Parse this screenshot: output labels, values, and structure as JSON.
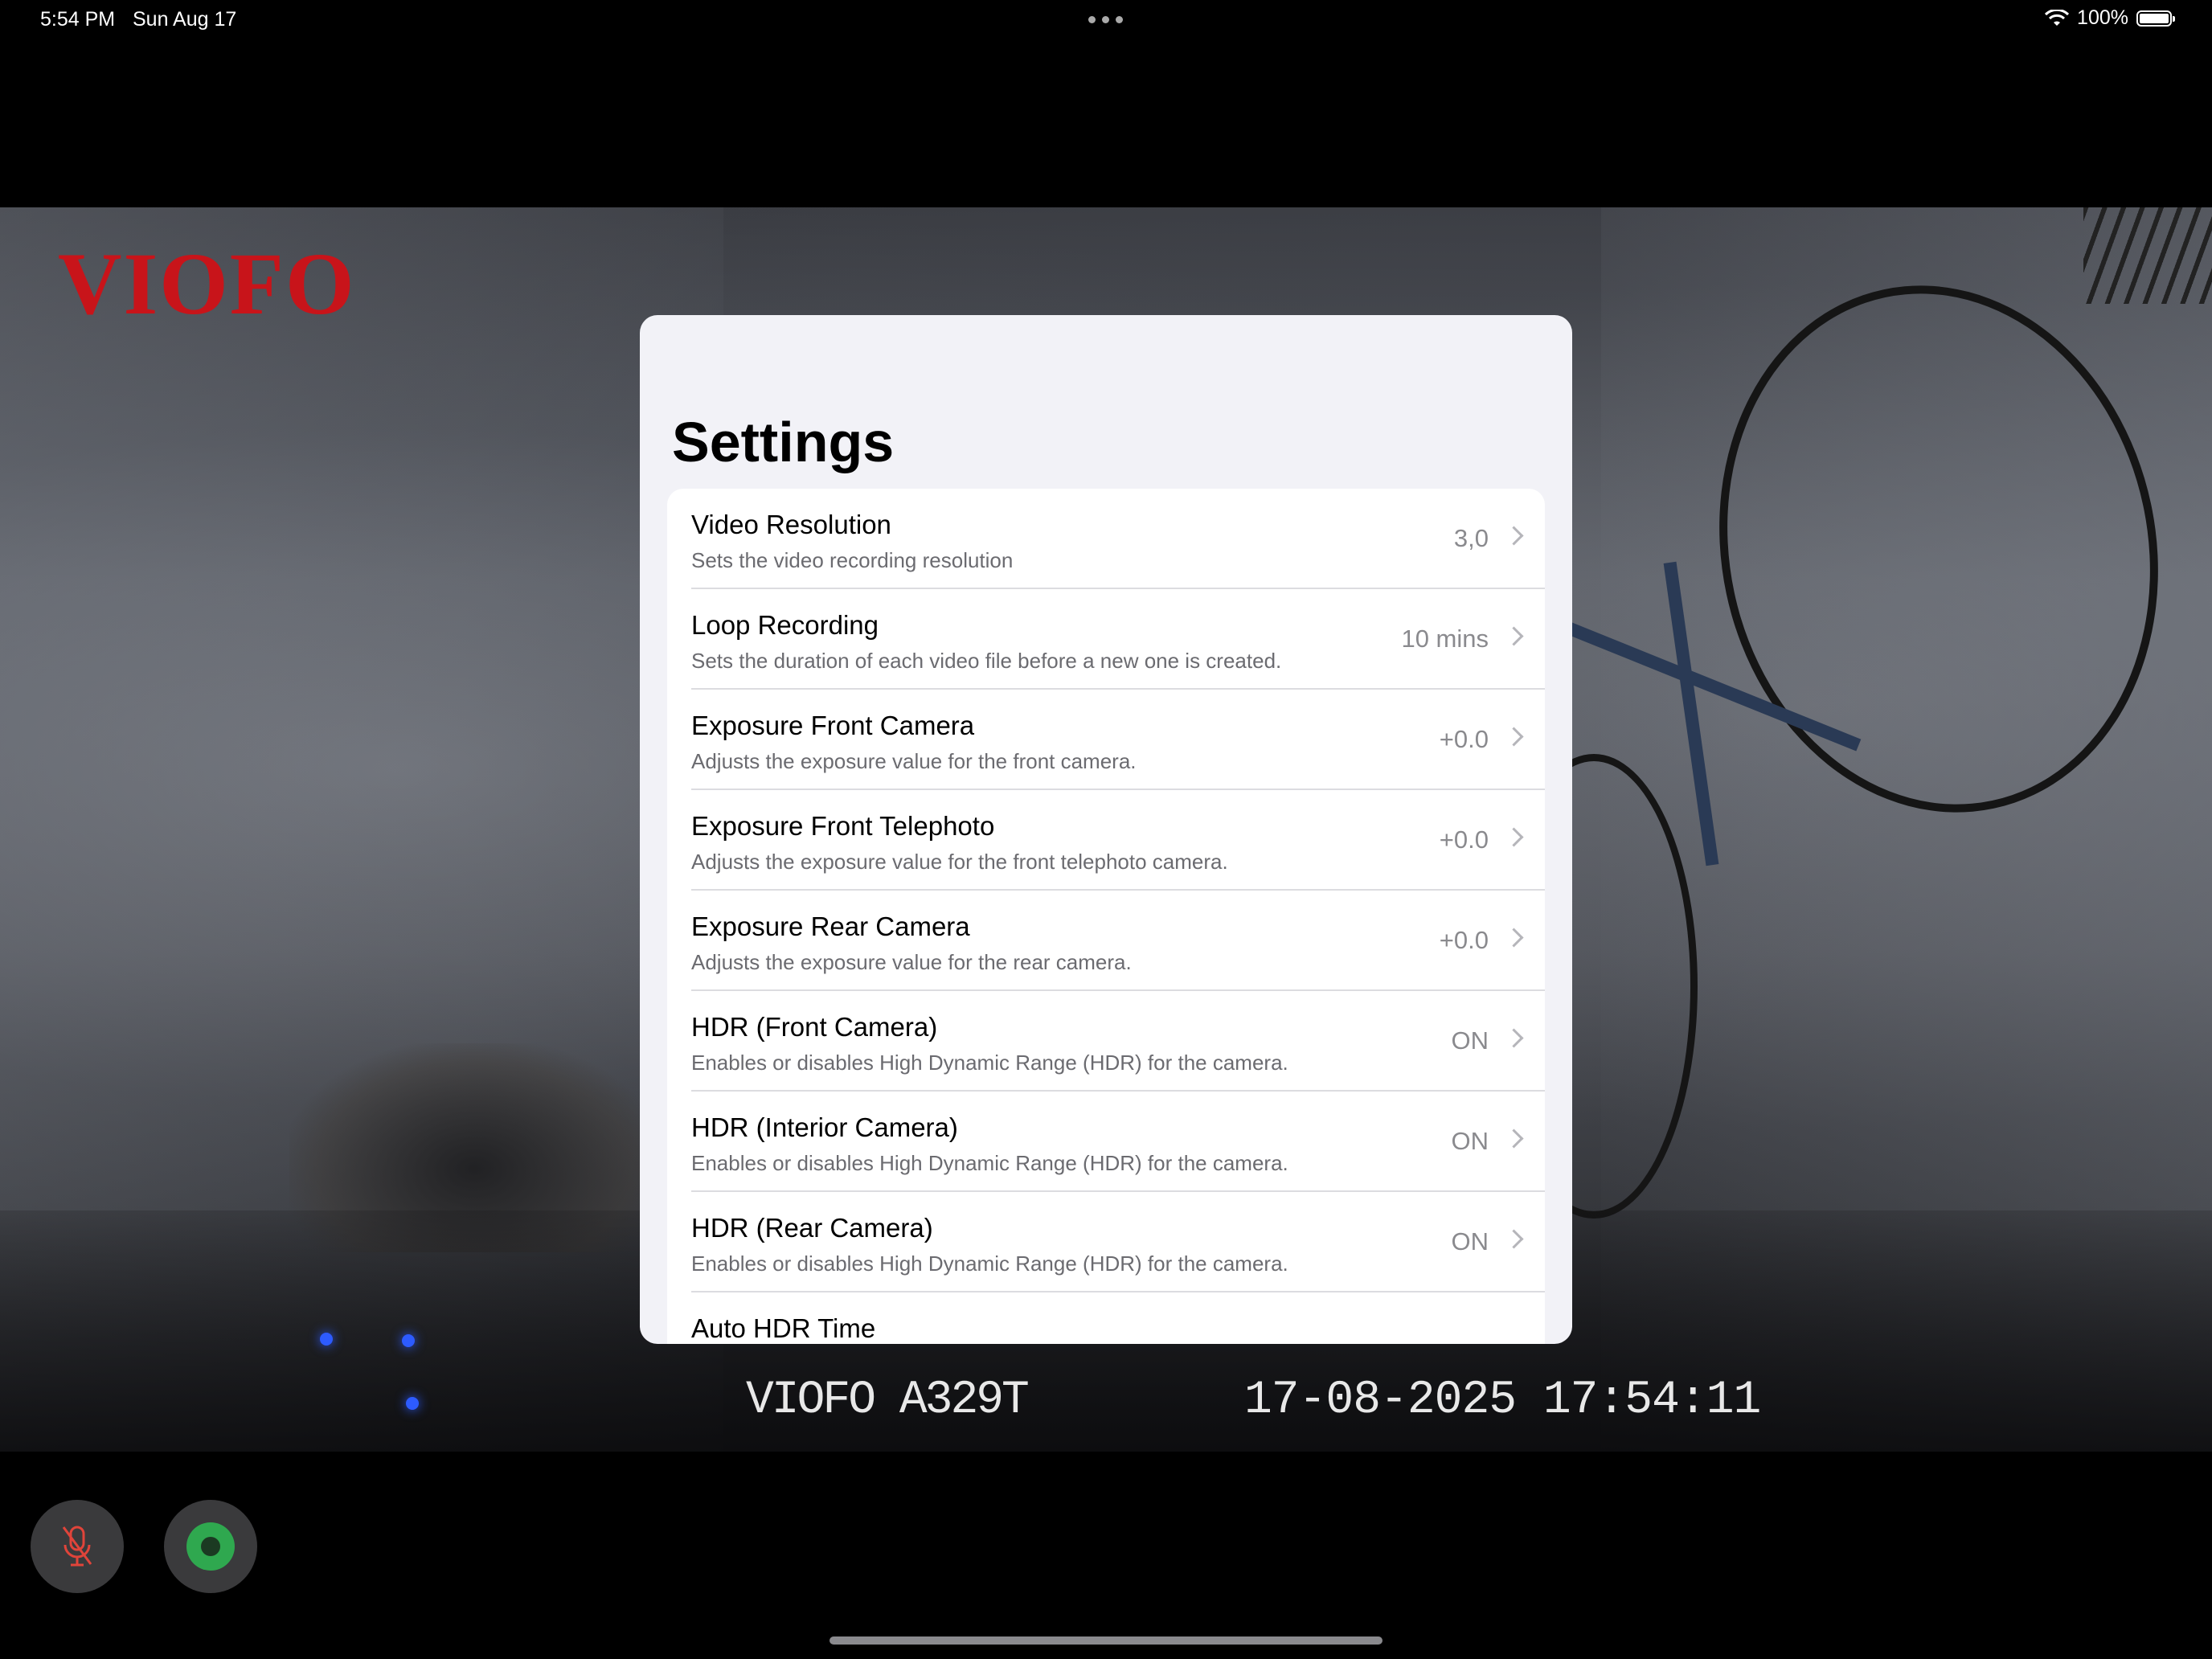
{
  "status_bar": {
    "time": "5:54 PM",
    "date": "Sun Aug 17",
    "battery_percent": "100%",
    "battery_level": 1.0
  },
  "feed": {
    "logo": "VIOFO",
    "model_overlay": "VIOFO A329T",
    "timestamp_overlay": "17-08-2025 17:54:11"
  },
  "settings": {
    "title": "Settings",
    "rows": [
      {
        "label": "Video Resolution",
        "sub": "Sets the video recording resolution",
        "value": "3,0"
      },
      {
        "label": "Loop Recording",
        "sub": "Sets the duration of each video file before a new one is created.",
        "value": "10 mins"
      },
      {
        "label": "Exposure Front Camera",
        "sub": "Adjusts the exposure value for the front camera.",
        "value": "+0.0"
      },
      {
        "label": "Exposure Front Telephoto",
        "sub": "Adjusts the exposure value for the front telephoto camera.",
        "value": "+0.0"
      },
      {
        "label": "Exposure Rear Camera",
        "sub": "Adjusts the exposure value for the rear camera.",
        "value": "+0.0"
      },
      {
        "label": "HDR (Front Camera)",
        "sub": "Enables or disables High Dynamic Range (HDR) for the camera.",
        "value": "ON"
      },
      {
        "label": "HDR (Interior Camera)",
        "sub": "Enables or disables High Dynamic Range (HDR) for the camera.",
        "value": "ON"
      },
      {
        "label": "HDR (Rear Camera)",
        "sub": "Enables or disables High Dynamic Range (HDR) for the camera.",
        "value": "ON"
      },
      {
        "label": "Auto HDR Time",
        "sub": "",
        "value": ""
      }
    ]
  },
  "controls": {
    "mic_icon": "mic-muted-icon",
    "record_icon": "record-icon",
    "accent_record": "#2fa84f",
    "accent_mic": "#e0443a"
  }
}
